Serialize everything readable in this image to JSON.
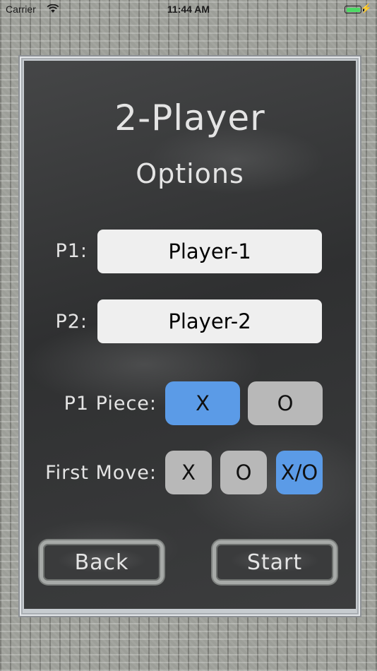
{
  "status_bar": {
    "carrier": "Carrier",
    "wifi_icon": "wifi-icon",
    "time": "11:44 AM",
    "battery_icon": "battery-icon",
    "battery_level": 1.0,
    "battery_color": "#4cd964",
    "charging_icon": "charging-bolt-icon"
  },
  "header": {
    "title": "2-Player",
    "subtitle": "Options"
  },
  "players": {
    "p1_label": "P1:",
    "p1_name": "Player-1",
    "p2_label": "P2:",
    "p2_name": "Player-2"
  },
  "p1_piece": {
    "label": "P1 Piece:",
    "options": [
      "X",
      "O"
    ],
    "selected": "X"
  },
  "first_move": {
    "label": "First Move:",
    "options": [
      "X",
      "O",
      "X/O"
    ],
    "selected": "X/O"
  },
  "nav": {
    "back_label": "Back",
    "start_label": "Start"
  },
  "colors": {
    "selected": "#5b9be7",
    "unselected": "#b8b8b8",
    "chalk_text": "#e4e4e4",
    "board": "#3a3b3c"
  }
}
